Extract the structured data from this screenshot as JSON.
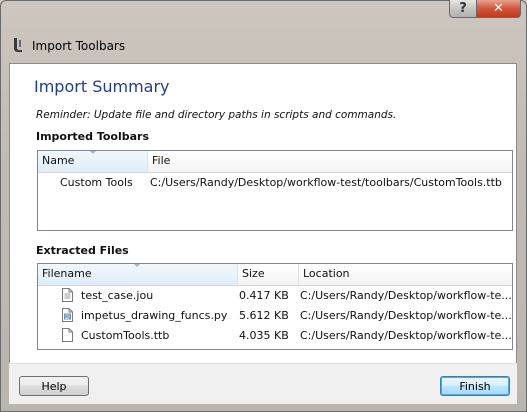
{
  "window": {
    "title": "Import Toolbars",
    "help_glyph": "?",
    "close_glyph": "✕"
  },
  "summary": {
    "title": "Import Summary",
    "reminder": "Reminder: Update file and directory paths in scripts and commands."
  },
  "imported_toolbars": {
    "label": "Imported Toolbars",
    "columns": [
      "Name",
      "File"
    ],
    "rows": [
      {
        "name": "Custom Tools",
        "file": "C:/Users/Randy/Desktop/workflow-test/toolbars/CustomTools.ttb"
      }
    ]
  },
  "extracted_files": {
    "label": "Extracted Files",
    "columns": [
      "Filename",
      "Size",
      "Location"
    ],
    "rows": [
      {
        "filename": "test_case.jou",
        "size": "0.417 KB",
        "location": "C:/Users/Randy/Desktop/workflow-te...",
        "icon": "text-file-icon"
      },
      {
        "filename": "impetus_drawing_funcs.py",
        "size": "5.612 KB",
        "location": "C:/Users/Randy/Desktop/workflow-te...",
        "icon": "script-file-icon"
      },
      {
        "filename": "CustomTools.ttb",
        "size": "4.035 KB",
        "location": "C:/Users/Randy/Desktop/workflow-te...",
        "icon": "blank-file-icon"
      }
    ]
  },
  "buttons": {
    "help": "Help",
    "finish": "Finish"
  },
  "colors": {
    "heading": "#1e3e8c",
    "close_button": "#c03a1d",
    "default_button_border": "#3c7fb1"
  }
}
